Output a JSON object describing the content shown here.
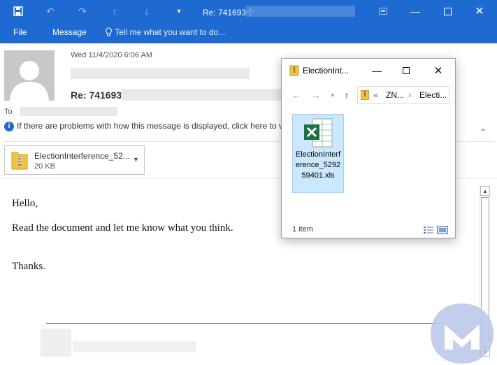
{
  "window": {
    "title": "Re: 741693个",
    "controls": [
      "minimize",
      "restore",
      "maximize",
      "close"
    ]
  },
  "ribbon": {
    "file": "File",
    "message": "Message",
    "tell_me": "Tell me what you want to do..."
  },
  "email": {
    "date": "Wed 11/4/2020 6:06 AM",
    "subject": "Re: 741693",
    "to_label": "To",
    "info_text": "If there are problems with how this message is displayed, click here to vi"
  },
  "attachment": {
    "name": "ElectionInterference_52...",
    "size": "20 KB"
  },
  "body": {
    "lines": [
      "Hello,",
      "Read the document and let me know what you think.",
      "Thanks."
    ]
  },
  "explorer": {
    "title": "ElectionInt...",
    "address_prefix": "«",
    "address_parts": [
      "ZN...",
      "Electi..."
    ],
    "file_name": "ElectionInterference_529259401.xls",
    "status": "1 item"
  },
  "colors": {
    "accent": "#1f6ad0",
    "selection": "#cce8ff",
    "excel_green": "#1d7044",
    "watermark": "#b7c6e8"
  },
  "icons": [
    "save-icon",
    "undo-icon",
    "redo-icon",
    "up-arrow-icon",
    "down-arrow-icon",
    "customize-icon",
    "lightbulb-icon",
    "info-icon",
    "zip-folder-icon",
    "excel-file-icon",
    "watermark-logo"
  ]
}
